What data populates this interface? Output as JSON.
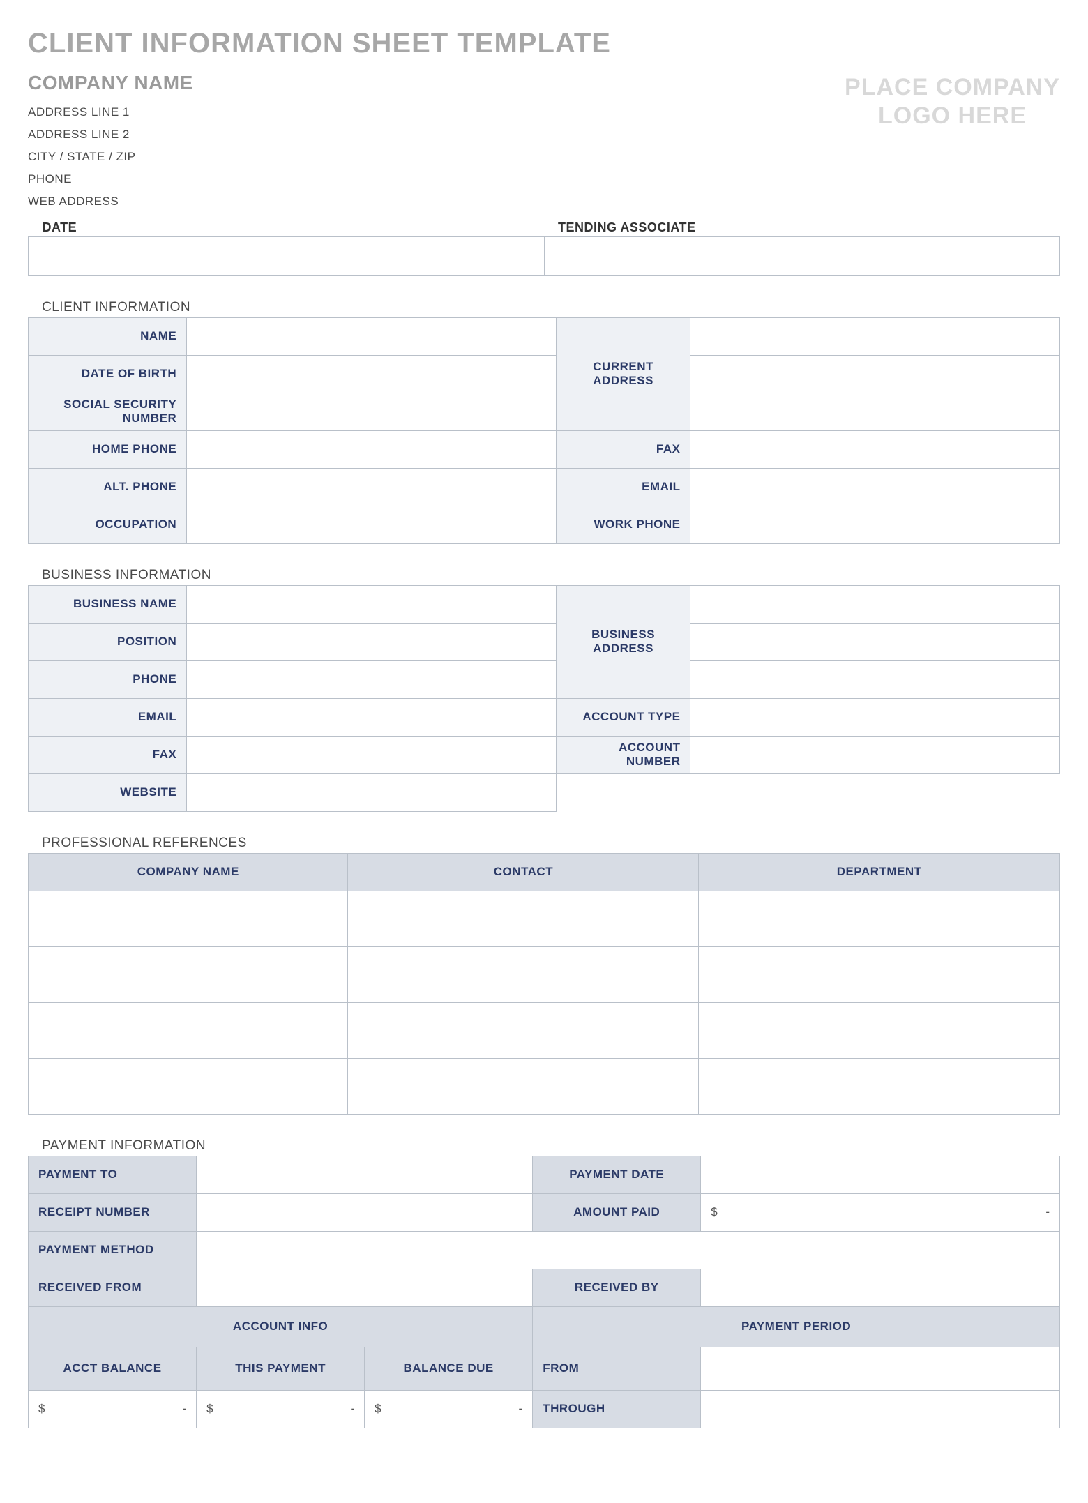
{
  "page_title": "CLIENT INFORMATION SHEET TEMPLATE",
  "company": {
    "name_label": "COMPANY NAME",
    "address1": "ADDRESS LINE 1",
    "address2": "ADDRESS LINE 2",
    "city_state_zip": "CITY / STATE / ZIP",
    "phone": "PHONE",
    "web": "WEB ADDRESS",
    "logo_line1": "PLACE COMPANY",
    "logo_line2": "LOGO HERE"
  },
  "top": {
    "date_label": "DATE",
    "associate_label": "TENDING ASSOCIATE"
  },
  "client_info": {
    "section": "CLIENT INFORMATION",
    "name": "NAME",
    "dob": "DATE OF BIRTH",
    "ssn1": "SOCIAL SECURITY",
    "ssn2": "NUMBER",
    "home_phone": "HOME PHONE",
    "alt_phone": "ALT. PHONE",
    "occupation": "OCCUPATION",
    "current_address": "CURRENT ADDRESS",
    "fax": "FAX",
    "email": "EMAIL",
    "work_phone": "WORK PHONE"
  },
  "business_info": {
    "section": "BUSINESS INFORMATION",
    "business_name": "BUSINESS NAME",
    "position": "POSITION",
    "phone": "PHONE",
    "email": "EMAIL",
    "fax": "FAX",
    "website": "WEBSITE",
    "business_address": "BUSINESS ADDRESS",
    "account_type": "ACCOUNT TYPE",
    "account_number": "ACCOUNT NUMBER"
  },
  "references": {
    "section": "PROFESSIONAL REFERENCES",
    "company": "COMPANY NAME",
    "contact": "CONTACT",
    "department": "DEPARTMENT"
  },
  "payment": {
    "section": "PAYMENT INFORMATION",
    "payment_to": "PAYMENT TO",
    "receipt_number": "RECEIPT NUMBER",
    "payment_method": "PAYMENT METHOD",
    "received_from": "RECEIVED FROM",
    "payment_date": "PAYMENT DATE",
    "amount_paid": "AMOUNT PAID",
    "received_by": "RECEIVED BY",
    "account_info": "ACCOUNT INFO",
    "payment_period": "PAYMENT PERIOD",
    "acct_balance": "ACCT BALANCE",
    "this_payment": "THIS PAYMENT",
    "balance_due": "BALANCE DUE",
    "from": "FROM",
    "through": "THROUGH",
    "currency": "$",
    "dash": "-"
  }
}
